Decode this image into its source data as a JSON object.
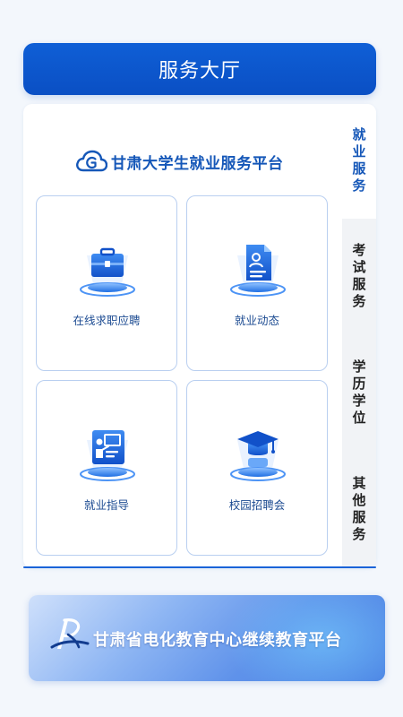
{
  "header": {
    "title": "服务大厅"
  },
  "platform": {
    "name": "甘肃大学生就业服务平台"
  },
  "cards": [
    {
      "label": "在线求职应聘",
      "icon": "briefcase-icon"
    },
    {
      "label": "就业动态",
      "icon": "document-person-icon"
    },
    {
      "label": "就业指导",
      "icon": "presentation-board-icon"
    },
    {
      "label": "校园招聘会",
      "icon": "graduation-cap-icon"
    }
  ],
  "tabs": [
    {
      "label": "就业服务",
      "active": true
    },
    {
      "label": "考试服务",
      "active": false
    },
    {
      "label": "学历学位",
      "active": false
    },
    {
      "label": "其他服务",
      "active": false
    }
  ],
  "banner": {
    "text": "甘肃省电化教育中心继续教育平台"
  },
  "colors": {
    "primary": "#0a4fc4",
    "brand_text": "#1557b8",
    "card_border": "#b9cff0",
    "card_label": "#1b4a91",
    "inactive_tab_bg": "#f1f3f6"
  }
}
